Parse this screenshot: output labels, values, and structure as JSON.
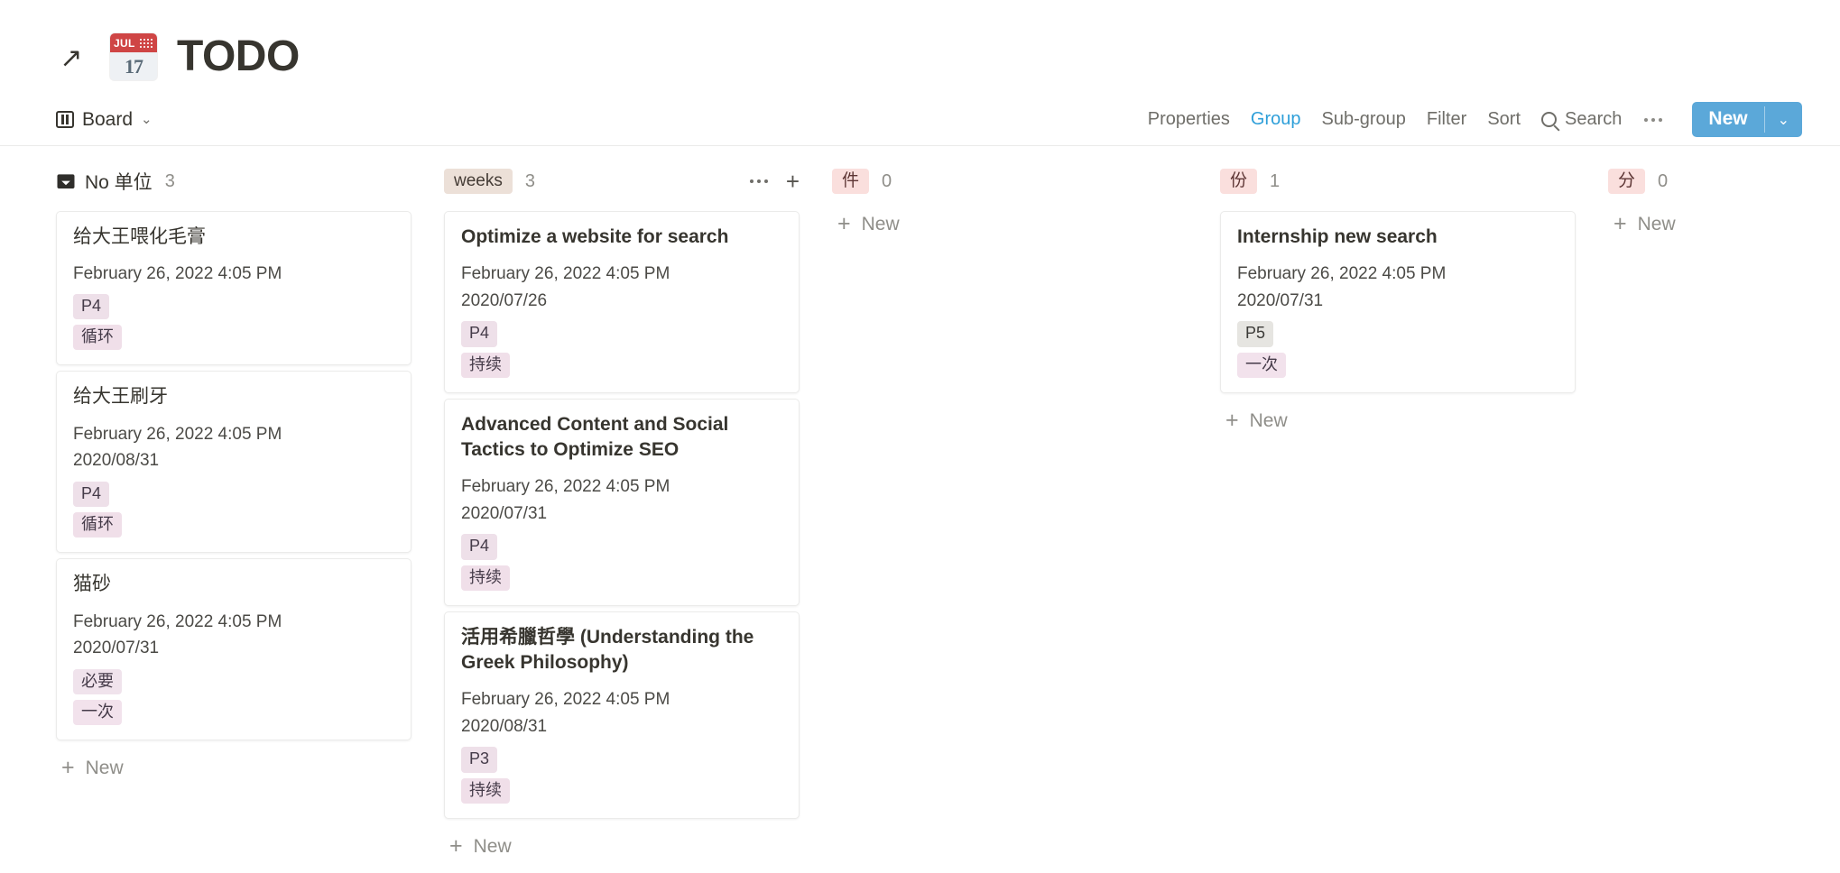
{
  "header": {
    "open_icon": "arrow-up-right-icon",
    "emoji": {
      "name": "calendar-emoji",
      "month": "JUL",
      "day": "17"
    },
    "title": "TODO"
  },
  "toolbar": {
    "view_icon": "board-icon",
    "view_label": "Board",
    "view_chevron": "⌄",
    "items": [
      {
        "label": "Properties",
        "active": false
      },
      {
        "label": "Group",
        "active": true
      },
      {
        "label": "Sub-group",
        "active": false
      },
      {
        "label": "Filter",
        "active": false
      },
      {
        "label": "Sort",
        "active": false
      }
    ],
    "search_label": "Search",
    "search_icon": "search-icon",
    "more_icon": "more-horizontal-icon",
    "new_label": "New",
    "new_chevron": "⌄",
    "accent_color": "#5ba8d9",
    "active_color": "#2e9fd9"
  },
  "board": {
    "add_new_label": "New",
    "columns": [
      {
        "id": "no-unit",
        "icon": "inbox-icon",
        "label": "No 单位",
        "chip": false,
        "chip_bg": "",
        "chip_fg": "",
        "count": "3",
        "show_head_actions": false,
        "cards": [
          {
            "title": "给大王喂化毛膏",
            "title_is_english": false,
            "date": "February 26, 2022 4:05 PM",
            "date2": "",
            "tags": [
              {
                "label": "P4",
                "bg": "#eee0e9",
                "fg": "#453b49"
              },
              {
                "label": "循环",
                "bg": "#f0dfe9",
                "fg": "#453b49"
              }
            ]
          },
          {
            "title": "给大王刷牙",
            "title_is_english": false,
            "date": "February 26, 2022 4:05 PM",
            "date2": "2020/08/31",
            "tags": [
              {
                "label": "P4",
                "bg": "#eee0e9",
                "fg": "#453b49"
              },
              {
                "label": "循环",
                "bg": "#f0dfe9",
                "fg": "#453b49"
              }
            ]
          },
          {
            "title": "猫砂",
            "title_is_english": false,
            "date": "February 26, 2022 4:05 PM",
            "date2": "2020/07/31",
            "tags": [
              {
                "label": "必要",
                "bg": "#f0e3ec",
                "fg": "#453b49"
              },
              {
                "label": "一次",
                "bg": "#f2e2ec",
                "fg": "#453b49"
              }
            ]
          }
        ]
      },
      {
        "id": "weeks",
        "icon": "",
        "label": "weeks",
        "chip": true,
        "chip_bg": "#ece0d8",
        "chip_fg": "#443b35",
        "count": "3",
        "show_head_actions": true,
        "cards": [
          {
            "title": "Optimize a website for search",
            "title_is_english": true,
            "date": "February 26, 2022 4:05 PM",
            "date2": "2020/07/26",
            "tags": [
              {
                "label": "P4",
                "bg": "#eee0e9",
                "fg": "#453b49"
              },
              {
                "label": "持续",
                "bg": "#f0dfe9",
                "fg": "#453b49"
              }
            ]
          },
          {
            "title": "Advanced Content and Social Tactics to Optimize SEO",
            "title_is_english": true,
            "date": "February 26, 2022 4:05 PM",
            "date2": "2020/07/31",
            "tags": [
              {
                "label": "P4",
                "bg": "#eee0e9",
                "fg": "#453b49"
              },
              {
                "label": "持续",
                "bg": "#f0dfe9",
                "fg": "#453b49"
              }
            ]
          },
          {
            "title": "活用希臘哲學 (Understanding the Greek Philosophy)",
            "title_is_english": true,
            "date": "February 26, 2022 4:05 PM",
            "date2": "2020/08/31",
            "tags": [
              {
                "label": "P3",
                "bg": "#eee0e9",
                "fg": "#453b49"
              },
              {
                "label": "持续",
                "bg": "#f0dfe9",
                "fg": "#453b49"
              }
            ]
          }
        ]
      },
      {
        "id": "jian",
        "icon": "",
        "label": "件",
        "chip": true,
        "chip_bg": "#fadfdd",
        "chip_fg": "#5d3534",
        "count": "0",
        "show_head_actions": false,
        "cards": []
      },
      {
        "id": "fen-copy",
        "icon": "",
        "label": "份",
        "chip": true,
        "chip_bg": "#fadfdd",
        "chip_fg": "#5d3534",
        "count": "1",
        "show_head_actions": false,
        "cards": [
          {
            "title": "Internship new search",
            "title_is_english": true,
            "date": "February 26, 2022 4:05 PM",
            "date2": "2020/07/31",
            "tags": [
              {
                "label": "P5",
                "bg": "#e6e5e1",
                "fg": "#3c3b38"
              },
              {
                "label": "一次",
                "bg": "#f2e2ec",
                "fg": "#453b49"
              }
            ]
          }
        ]
      },
      {
        "id": "fen-minute",
        "icon": "",
        "label": "分",
        "chip": true,
        "chip_bg": "#fadfdd",
        "chip_fg": "#5d3534",
        "count": "0",
        "show_head_actions": false,
        "cards": []
      }
    ]
  }
}
